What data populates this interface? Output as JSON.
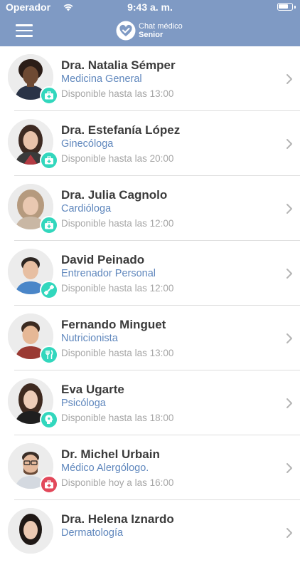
{
  "status_bar": {
    "carrier": "Operador",
    "time": "9:43 a. m."
  },
  "header": {
    "app_name_line1": "Chat médico",
    "app_name_line2": "Senior"
  },
  "colors": {
    "header_bg": "#7f9ac4",
    "specialty_text": "#5f87bd",
    "badge_teal": "#32d7bd",
    "badge_red": "#e2485a"
  },
  "doctors": [
    {
      "name": "Dra. Natalia Sémper",
      "specialty": "Medicina General",
      "availability": "Disponible hasta las 13:00",
      "badge_icon": "medical-bag-icon",
      "badge_color": "#32d7bd"
    },
    {
      "name": "Dra. Estefanía López",
      "specialty": "Ginecóloga",
      "availability": "Disponible hasta las 20:00",
      "badge_icon": "medical-bag-icon",
      "badge_color": "#32d7bd"
    },
    {
      "name": "Dra. Julia Cagnolo",
      "specialty": "Cardióloga",
      "availability": "Disponible hasta las 12:00",
      "badge_icon": "medical-bag-icon",
      "badge_color": "#32d7bd"
    },
    {
      "name": "David Peinado",
      "specialty": "Entrenador Personal",
      "availability": "Disponible hasta las 12:00",
      "badge_icon": "dumbbell-icon",
      "badge_color": "#32d7bd"
    },
    {
      "name": "Fernando Minguet",
      "specialty": "Nutricionista",
      "availability": "Disponible hasta las 13:00",
      "badge_icon": "cutlery-icon",
      "badge_color": "#32d7bd"
    },
    {
      "name": "Eva Ugarte",
      "specialty": "Psicóloga",
      "availability": "Disponible hasta las 18:00",
      "badge_icon": "head-icon",
      "badge_color": "#32d7bd"
    },
    {
      "name": "Dr. Michel Urbain",
      "specialty": "Médico Alergólogo.",
      "availability": "Disponible hoy a las 16:00",
      "badge_icon": "medical-bag-icon",
      "badge_color": "#e2485a"
    },
    {
      "name": "Dra. Helena Iznardo",
      "specialty": "Dermatología",
      "availability": "",
      "badge_icon": "medical-bag-icon",
      "badge_color": "#32d7bd"
    }
  ]
}
